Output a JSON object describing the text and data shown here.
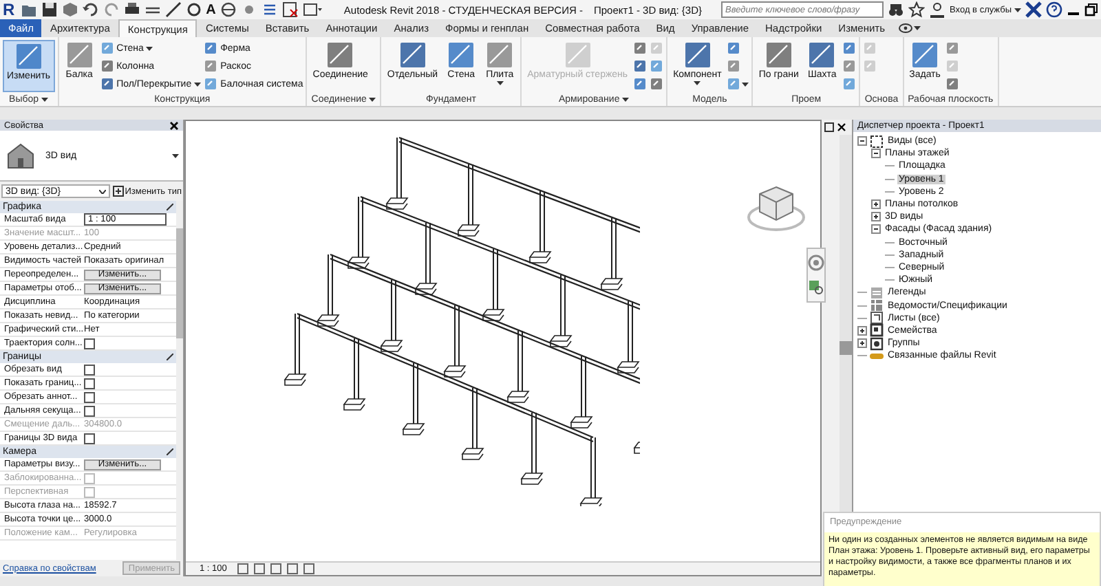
{
  "title_bar": {
    "logo": "R",
    "quick_access_letter": "A",
    "title": "Autodesk Revit 2018 - СТУДЕНЧЕСКАЯ ВЕРСИЯ -",
    "document": "Проект1 - 3D вид: {3D}",
    "search": {
      "placeholder": "Введите ключевое слово/фразу"
    },
    "sign_in": "Вход в службы"
  },
  "tabs": [
    {
      "label": "Файл",
      "kind": "app",
      "selected": false
    },
    {
      "label": "Архитектура",
      "kind": "tab",
      "selected": false
    },
    {
      "label": "Конструкция",
      "kind": "tab",
      "selected": true
    },
    {
      "label": "Системы",
      "kind": "tab",
      "selected": false
    },
    {
      "label": "Вставить",
      "kind": "tab",
      "selected": false
    },
    {
      "label": "Аннотации",
      "kind": "tab",
      "selected": false
    },
    {
      "label": "Анализ",
      "kind": "tab",
      "selected": false
    },
    {
      "label": "Формы и генплан",
      "kind": "tab",
      "selected": false
    },
    {
      "label": "Совместная работа",
      "kind": "tab",
      "selected": false
    },
    {
      "label": "Вид",
      "kind": "tab",
      "selected": false
    },
    {
      "label": "Управление",
      "kind": "tab",
      "selected": false
    },
    {
      "label": "Надстройки",
      "kind": "tab",
      "selected": false
    },
    {
      "label": "Изменить",
      "kind": "tab",
      "selected": false
    }
  ],
  "ribbon": [
    {
      "label": "Выбор",
      "dropdown": true,
      "groups": [
        [
          {
            "kind": "large",
            "label": "Изменить",
            "selected": true,
            "disabled": false,
            "dropdown": false
          }
        ]
      ]
    },
    {
      "label": "Конструкция",
      "dropdown": false,
      "groups": [
        [
          {
            "kind": "large",
            "label": "Балка",
            "selected": false,
            "disabled": false,
            "dropdown": false
          }
        ],
        [
          {
            "kind": "small",
            "label": "Стена",
            "selected": false,
            "disabled": false,
            "dropdown": true
          },
          {
            "kind": "small",
            "label": "Колонна",
            "selected": false,
            "disabled": false,
            "dropdown": false
          },
          {
            "kind": "small",
            "label": "Пол/Перекрытие",
            "selected": false,
            "disabled": false,
            "dropdown": true
          }
        ],
        [
          {
            "kind": "small",
            "label": "Ферма",
            "selected": false,
            "disabled": false,
            "dropdown": false
          },
          {
            "kind": "small",
            "label": "Раскос",
            "selected": false,
            "disabled": false,
            "dropdown": false
          },
          {
            "kind": "small",
            "label": "Балочная система",
            "selected": false,
            "disabled": false,
            "dropdown": false
          }
        ]
      ]
    },
    {
      "label": "Соединение",
      "dropdown": true,
      "groups": [
        [
          {
            "kind": "large",
            "label": "Соединение",
            "selected": false,
            "disabled": false,
            "dropdown": false
          }
        ]
      ]
    },
    {
      "label": "Фундамент",
      "dropdown": false,
      "groups": [
        [
          {
            "kind": "large",
            "label": "Отдельный",
            "selected": false,
            "disabled": false,
            "dropdown": false
          }
        ],
        [
          {
            "kind": "large",
            "label": "Стена",
            "selected": false,
            "disabled": false,
            "dropdown": false
          }
        ],
        [
          {
            "kind": "large",
            "label": "Плита",
            "selected": false,
            "disabled": false,
            "dropdown": true
          }
        ]
      ]
    },
    {
      "label": "Армирование",
      "dropdown": true,
      "groups": [
        [
          {
            "kind": "large",
            "label": "Арматурный стержень",
            "selected": false,
            "disabled": true,
            "dropdown": false
          }
        ],
        [
          {
            "kind": "icon",
            "selected": false,
            "disabled": false,
            "dropdown": false
          },
          {
            "kind": "icon",
            "selected": false,
            "disabled": false,
            "dropdown": false
          },
          {
            "kind": "icon",
            "selected": false,
            "disabled": false,
            "dropdown": false
          }
        ],
        [
          {
            "kind": "icon",
            "selected": false,
            "disabled": true,
            "dropdown": false
          },
          {
            "kind": "icon",
            "selected": false,
            "disabled": false,
            "dropdown": false
          },
          {
            "kind": "icon",
            "selected": false,
            "disabled": false,
            "dropdown": false
          }
        ]
      ]
    },
    {
      "label": "Модель",
      "dropdown": false,
      "groups": [
        [
          {
            "kind": "large",
            "label": "Компонент",
            "selected": false,
            "disabled": false,
            "dropdown": true
          }
        ],
        [
          {
            "kind": "icon",
            "selected": false,
            "disabled": false,
            "dropdown": false
          },
          {
            "kind": "icon",
            "selected": false,
            "disabled": false,
            "dropdown": false
          },
          {
            "kind": "icon",
            "selected": false,
            "disabled": false,
            "dropdown": true
          }
        ]
      ]
    },
    {
      "label": "Проем",
      "dropdown": false,
      "groups": [
        [
          {
            "kind": "large",
            "label": "По грани",
            "selected": false,
            "disabled": false,
            "dropdown": false
          }
        ],
        [
          {
            "kind": "large",
            "label": "Шахта",
            "selected": false,
            "disabled": false,
            "dropdown": false
          }
        ],
        [
          {
            "kind": "icon",
            "selected": false,
            "disabled": false,
            "dropdown": false
          },
          {
            "kind": "icon",
            "selected": false,
            "disabled": false,
            "dropdown": false
          },
          {
            "kind": "icon",
            "selected": false,
            "disabled": false,
            "dropdown": false
          }
        ]
      ]
    },
    {
      "label": "Основа",
      "dropdown": false,
      "groups": [
        [
          {
            "kind": "icon",
            "selected": false,
            "disabled": true,
            "dropdown": false
          },
          {
            "kind": "icon",
            "selected": false,
            "disabled": true,
            "dropdown": false
          }
        ]
      ]
    },
    {
      "label": "Рабочая плоскость",
      "dropdown": false,
      "groups": [
        [
          {
            "kind": "large",
            "label": "Задать",
            "selected": false,
            "disabled": false,
            "dropdown": false
          }
        ],
        [
          {
            "kind": "icon",
            "selected": false,
            "disabled": false,
            "dropdown": false
          },
          {
            "kind": "icon",
            "selected": false,
            "disabled": true,
            "dropdown": false
          },
          {
            "kind": "icon",
            "selected": false,
            "disabled": false,
            "dropdown": false
          }
        ]
      ]
    }
  ],
  "properties": {
    "title": "Свойства",
    "type_name": "3D вид",
    "view_selector": "3D вид: {3D}",
    "edit_type": "Изменить тип",
    "sections": [
      {
        "title": "Графика",
        "rows": [
          {
            "label": "Масштаб вида",
            "kind": "input",
            "value": "1 : 100",
            "disabled": false
          },
          {
            "label": "Значение масшт...",
            "kind": "text",
            "value": "100",
            "disabled": true
          },
          {
            "label": "Уровень детализ...",
            "kind": "text",
            "value": "Средний",
            "disabled": false
          },
          {
            "label": "Видимость частей",
            "kind": "text",
            "value": "Показать оригинал",
            "disabled": false
          },
          {
            "label": "Переопределен...",
            "kind": "button",
            "value": "Изменить...",
            "disabled": false
          },
          {
            "label": "Параметры отоб...",
            "kind": "button",
            "value": "Изменить...",
            "disabled": false
          },
          {
            "label": "Дисциплина",
            "kind": "text",
            "value": "Координация",
            "disabled": false
          },
          {
            "label": "Показать невид...",
            "kind": "text",
            "value": "По категории",
            "disabled": false
          },
          {
            "label": "Графический сти...",
            "kind": "text",
            "value": "Нет",
            "disabled": false
          },
          {
            "label": "Траектория солн...",
            "kind": "checkbox",
            "checked": false,
            "disabled": false
          }
        ]
      },
      {
        "title": "Границы",
        "rows": [
          {
            "label": "Обрезать вид",
            "kind": "checkbox",
            "checked": false,
            "disabled": false
          },
          {
            "label": "Показать границ...",
            "kind": "checkbox",
            "checked": false,
            "disabled": false
          },
          {
            "label": "Обрезать аннот...",
            "kind": "checkbox",
            "checked": false,
            "disabled": false
          },
          {
            "label": "Дальняя секуща...",
            "kind": "checkbox",
            "checked": false,
            "disabled": false
          },
          {
            "label": "Смещение даль...",
            "kind": "text",
            "value": "304800.0",
            "disabled": true
          },
          {
            "label": "Границы 3D вида",
            "kind": "checkbox",
            "checked": false,
            "disabled": false
          }
        ]
      },
      {
        "title": "Камера",
        "rows": [
          {
            "label": "Параметры визу...",
            "kind": "button",
            "value": "Изменить...",
            "disabled": false
          },
          {
            "label": "Заблокированна...",
            "kind": "checkbox",
            "checked": false,
            "disabled": true
          },
          {
            "label": "Перспективная",
            "kind": "checkbox",
            "checked": false,
            "disabled": true
          },
          {
            "label": "Высота глаза на...",
            "kind": "text",
            "value": "18592.7",
            "disabled": false
          },
          {
            "label": "Высота точки це...",
            "kind": "text",
            "value": "3000.0",
            "disabled": false
          },
          {
            "label": "Положение кам...",
            "kind": "text",
            "value": "Регулировка",
            "disabled": true
          }
        ]
      }
    ],
    "help_link": "Справка по свойствам",
    "apply": {
      "label": "Применить",
      "disabled": true
    }
  },
  "view": {
    "scale": "1 : 100"
  },
  "project_browser": {
    "title": "Диспетчер проекта - Проект1",
    "tree": [
      {
        "label": "Виды (все)",
        "expanded": true,
        "selected": false,
        "children": [
          {
            "label": "Планы этажей",
            "expanded": true,
            "selected": false,
            "children": [
              {
                "label": "Площадка",
                "selected": false
              },
              {
                "label": "Уровень 1",
                "selected": true
              },
              {
                "label": "Уровень 2",
                "selected": false
              }
            ]
          },
          {
            "label": "Планы потолков",
            "expanded": false,
            "selected": false
          },
          {
            "label": "3D виды",
            "expanded": false,
            "selected": false
          },
          {
            "label": "Фасады (Фасад здания)",
            "expanded": true,
            "selected": false,
            "children": [
              {
                "label": "Восточный",
                "selected": false
              },
              {
                "label": "Западный",
                "selected": false
              },
              {
                "label": "Северный",
                "selected": false
              },
              {
                "label": "Южный",
                "selected": false
              }
            ]
          }
        ]
      },
      {
        "label": "Легенды",
        "selected": false
      },
      {
        "label": "Ведомости/Спецификации",
        "selected": false
      },
      {
        "label": "Листы (все)",
        "selected": false
      },
      {
        "label": "Семейства",
        "expanded": false,
        "selected": false
      },
      {
        "label": "Группы",
        "expanded": false,
        "selected": false
      },
      {
        "label": "Связанные файлы Revit",
        "selected": false
      }
    ]
  },
  "warning": {
    "title": "Предупреждение",
    "message": "Ни один из созданных элементов не является видимым на виде План этажа: Уровень 1. Проверьте активный вид, его параметры и настройку видимости, а также все фрагменты планов и их параметры."
  }
}
